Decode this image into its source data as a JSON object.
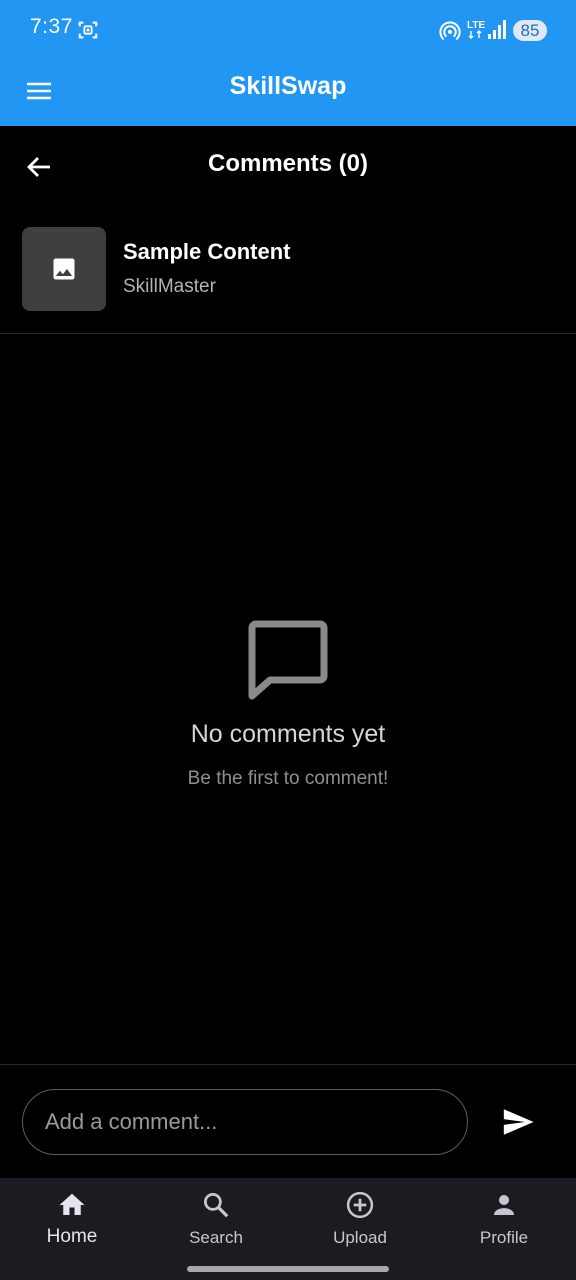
{
  "status_bar": {
    "time": "7:37",
    "network": "LTE",
    "battery": "85",
    "icons": [
      "screenshot-icon",
      "hotspot-icon",
      "lte-icon",
      "signal-icon",
      "battery-icon"
    ]
  },
  "app_bar": {
    "title": "SkillSwap",
    "menu_icon": "menu-icon",
    "color": "#2196f3"
  },
  "header": {
    "title": "Comments (0)",
    "back_icon": "arrow-back-icon"
  },
  "content": {
    "title": "Sample Content",
    "author": "SkillMaster",
    "thumbnail_icon": "image-icon"
  },
  "empty_state": {
    "icon": "chat-bubble-icon",
    "title": "No comments yet",
    "subtitle": "Be the first to comment!"
  },
  "comment_input": {
    "placeholder": "Add a comment...",
    "value": "",
    "send_icon": "send-icon"
  },
  "bottom_nav": {
    "items": [
      {
        "label": "Home",
        "icon": "home-icon",
        "active": true
      },
      {
        "label": "Search",
        "icon": "search-icon",
        "active": false
      },
      {
        "label": "Upload",
        "icon": "add-circle-icon",
        "active": false
      },
      {
        "label": "Profile",
        "icon": "person-icon",
        "active": false
      }
    ]
  }
}
